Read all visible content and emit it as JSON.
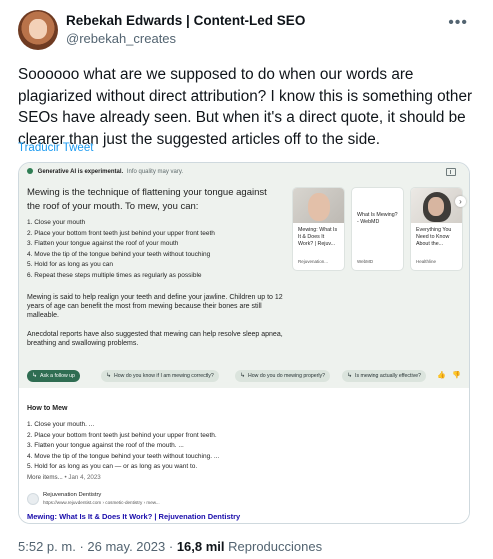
{
  "tweet": {
    "author_name": "Rebekah Edwards | Content-Led SEO",
    "author_handle": "@rebekah_creates",
    "more_icon": "more-horizontal-icon",
    "text": "Soooooo what are we supposed to do when our words are plagiarized without direct attribution? I know this is something other SEOs have already seen. But when it's a direct quote, it should be clearer than just the suggested articles off to the side.",
    "translate_label": "Traducir Tweet",
    "time": "5:52 p. m.",
    "date": "26 may. 2023",
    "separator": "·",
    "views_count": "16,8 mil",
    "views_label": "Reproducciones"
  },
  "ai_result": {
    "experimental_label": "Generative AI is experimental.",
    "quality_label": "Info quality may vary.",
    "heading": "Mewing is the technique of flattening your tongue against the roof of your mouth. To mew, you can:",
    "steps": [
      "1.  Close your mouth",
      "2.  Place your bottom front teeth just behind your upper front teeth",
      "3.  Flatten your tongue against the roof of your mouth",
      "4.  Move the tip of the tongue behind your teeth without touching",
      "5.  Hold for as long as you can",
      "6.  Repeat these steps multiple times as regularly as possible"
    ],
    "paragraph1": "Mewing is said to help realign your teeth and define your jawline. Children up to 12 years of age can benefit the most from mewing because their bones are still malleable.",
    "paragraph2": "Anecdotal reports have also suggested that mewing can help resolve sleep apnea, breathing and swallowing problems.",
    "source_cards": [
      {
        "title": "Mewing: What Is It & Does It Work? | Rejuv...",
        "site": "Rejuvenation..."
      },
      {
        "title": "What Is Mewing? - WebMD",
        "site": "WebMD"
      },
      {
        "title": "Everything You Need to Know About the...",
        "site": "Healthline"
      }
    ],
    "follow_label": "Ask a follow up",
    "chips": [
      "How do you know if I am mewing correctly?",
      "How do you do mewing properly?",
      "Is mewing actually effective?"
    ]
  },
  "organic_result": {
    "title": "How to Mew",
    "steps": [
      "1. Close your mouth. ...",
      "2. Place your bottom front teeth just behind your upper front teeth.",
      "3. Flatten your tongue against the roof of the mouth. ...",
      "4. Move the tip of the tongue behind your teeth without touching. ...",
      "5. Hold for as long as you can — or as long as you want to."
    ],
    "more_items": "More items...",
    "more_date": "• Jan 4, 2023",
    "site_name": "Rejuvenation Dentistry",
    "site_url": "https://www.rejuvdentist.com › cosmetic-dentistry › mew...",
    "link_title": "Mewing: What Is It & Does It Work? | Rejuvenation Dentistry"
  }
}
